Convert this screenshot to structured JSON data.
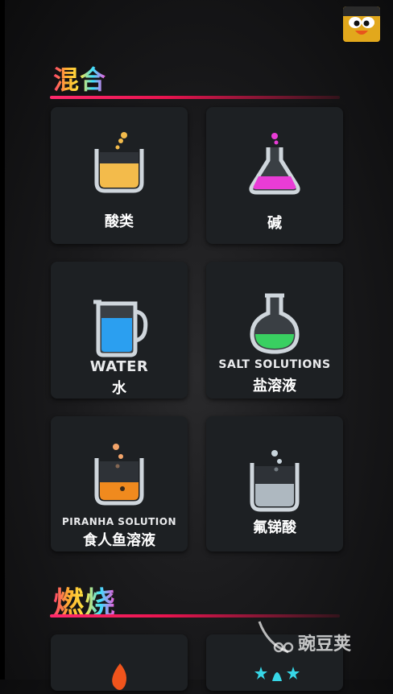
{
  "sections": {
    "mix": {
      "title": "混合"
    },
    "burn": {
      "title": "燃烧"
    }
  },
  "tiles": [
    {
      "en": "",
      "cn": "酸类",
      "icon": "beaker-yellow-icon",
      "liquid": "#f3bb4b"
    },
    {
      "en": "",
      "cn": "碱",
      "icon": "flask-pink-icon",
      "liquid": "#e93cd6"
    },
    {
      "en": "WATER",
      "cn": "水",
      "icon": "pitcher-blue-icon",
      "liquid": "#2b9ff0"
    },
    {
      "en": "SALT SOLUTIONS",
      "cn": "盐溶液",
      "icon": "round-flask-green-icon",
      "liquid": "#39d061"
    },
    {
      "en": "PIRANHA SOLUTION",
      "cn": "食人鱼溶液",
      "icon": "beaker-orange-icon",
      "liquid": "#f08a1e"
    },
    {
      "en": "",
      "cn": "氟锑酸",
      "icon": "beaker-clear-icon",
      "liquid": "#c8d4dc"
    }
  ],
  "watermark": {
    "text": "豌豆荚"
  },
  "colors": {
    "accent": "#e8144f",
    "tile_bg": "#1d2023"
  }
}
